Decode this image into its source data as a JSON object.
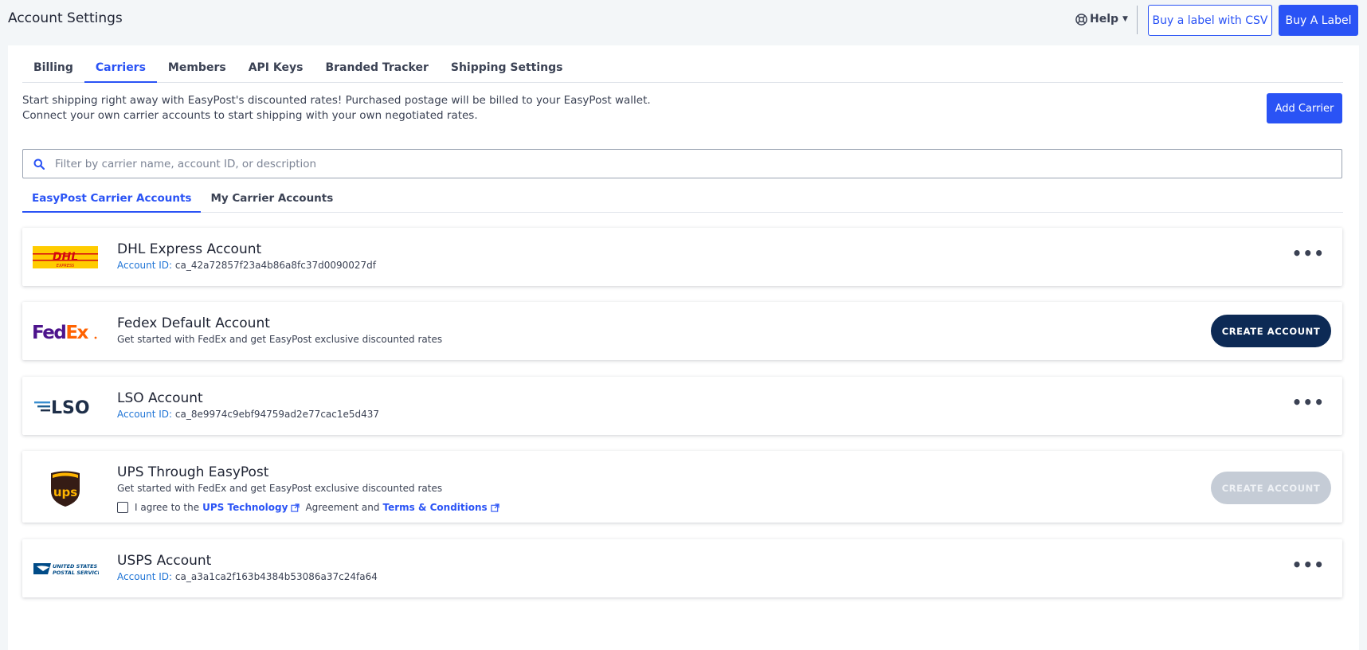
{
  "header": {
    "title": "Account Settings",
    "help_label": "Help",
    "buy_csv_label": "Buy a label with CSV",
    "buy_label": "Buy A Label"
  },
  "tabs": [
    {
      "label": "Billing"
    },
    {
      "label": "Carriers"
    },
    {
      "label": "Members"
    },
    {
      "label": "API Keys"
    },
    {
      "label": "Branded Tracker"
    },
    {
      "label": "Shipping Settings"
    }
  ],
  "active_tab": "Carriers",
  "intro": {
    "line1": "Start shipping right away with EasyPost's discounted rates! Purchased postage will be billed to your EasyPost wallet.",
    "line2": "Connect your own carrier accounts to start shipping with your own negotiated rates.",
    "add_carrier_label": "Add Carrier"
  },
  "search": {
    "placeholder": "Filter by carrier name, account ID, or description",
    "value": ""
  },
  "subtabs": [
    {
      "label": "EasyPost Carrier Accounts"
    },
    {
      "label": "My Carrier Accounts"
    }
  ],
  "carriers": [
    {
      "logo": "dhl-logo",
      "name": "DHL Express Account",
      "account_label": "Account ID:",
      "account_id": "ca_42a72857f23a4b86a8fc37d0090027df",
      "action": "menu"
    },
    {
      "logo": "fedex-logo",
      "name": "Fedex Default Account",
      "description": "Get started with FedEx and get EasyPost exclusive discounted rates",
      "action": "CREATE ACCOUNT"
    },
    {
      "logo": "lso-logo",
      "name": "LSO Account",
      "account_label": "Account ID:",
      "account_id": "ca_8e9974c9ebf94759ad2e77cac1e5d437",
      "action": "menu"
    },
    {
      "logo": "ups-logo",
      "name": "UPS Through EasyPost",
      "description": "Get started with FedEx and get EasyPost exclusive discounted rates",
      "agree_prefix": "I agree to the",
      "agree_link1": "UPS Technology",
      "agree_middle": "Agreement and",
      "agree_link2": "Terms & Conditions",
      "agree_checked": false,
      "action": "CREATE ACCOUNT",
      "action_disabled": true
    },
    {
      "logo": "usps-logo",
      "name": "USPS Account",
      "account_label": "Account ID:",
      "account_id": "ca_a3a1ca2f163b4384b53086a37c24fa64",
      "action": "menu"
    }
  ],
  "logo_text": {
    "dhl": "DHL",
    "dhl_sub": "EXPRESS",
    "fedex_fed": "Fed",
    "fedex_ex": "Ex",
    "lso": "LSO",
    "ups": "ups",
    "usps_line1": "UNITED STATES",
    "usps_line2": "POSTAL SERVICE"
  },
  "kebab_glyph": "•••",
  "colors": {
    "primary": "#2a53f5",
    "dark_button": "#0d2a55",
    "account_label": "#1f74d6",
    "background": "#f3f6f8"
  }
}
